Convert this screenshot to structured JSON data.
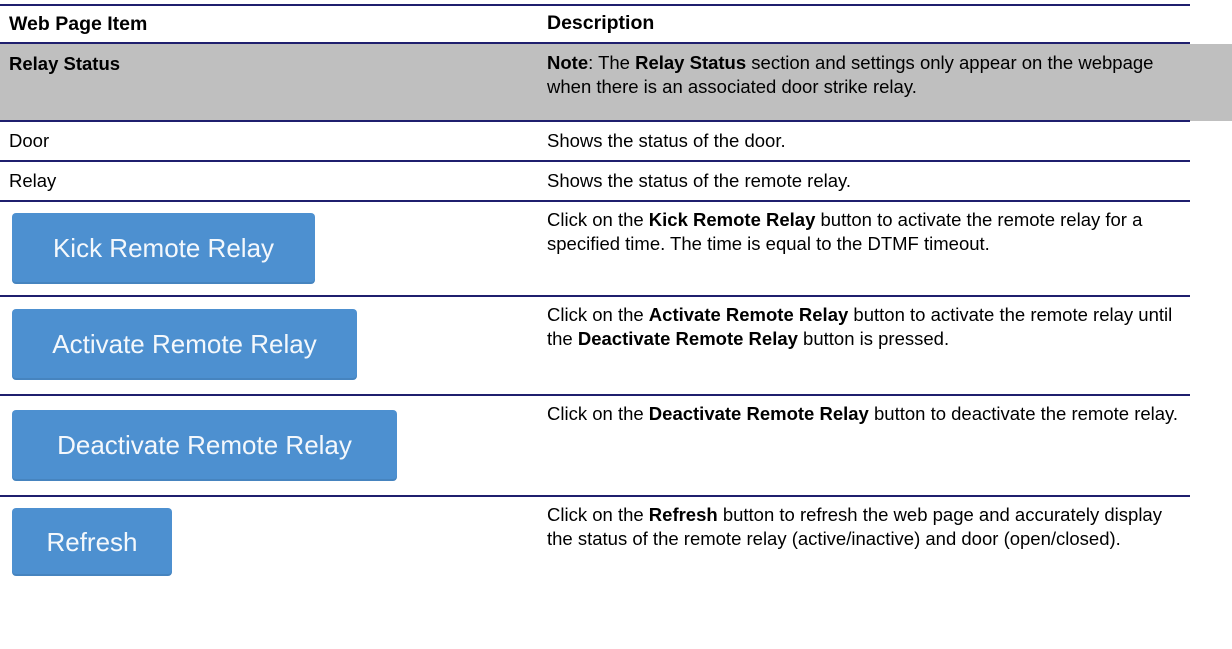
{
  "header": {
    "col1": "Web Page Item",
    "col2": "Description"
  },
  "section": {
    "title": "Relay Status",
    "note_label": "Note",
    "note_1": ": The ",
    "note_bold": "Relay Status",
    "note_2": " section and settings only appear on the webpage when there is an associated door strike relay."
  },
  "rows": [
    {
      "item": "Door",
      "description": "Shows the status of the door."
    },
    {
      "item": "Relay",
      "description": "Shows the status of the remote relay."
    }
  ],
  "buttons": [
    {
      "label": "Kick Remote Relay",
      "d1": "Click on the ",
      "b1": "Kick Remote Relay",
      "d2": " button to activate the remote relay for a specified time. The time is equal to the DTMF timeout."
    },
    {
      "label": "Activate Remote Relay",
      "d1": "Click on the ",
      "b1": "Activate Remote Relay",
      "d2": " button to activate the remote relay until the ",
      "b2": "Deactivate Remote Relay",
      "d3": " button is pressed."
    },
    {
      "label": "Deactivate Remote Relay",
      "d1": "Click on the ",
      "b1": "Deactivate Remote Relay",
      "d2": " button to deactivate the remote relay."
    },
    {
      "label": "Refresh",
      "d1": "Click on the ",
      "b1": "Refresh",
      "d2": " button to refresh the web page and accurately display the status of the remote relay (active/inactive) and door (open/closed)."
    }
  ],
  "colors": {
    "rule": "#1f1f6e",
    "section_bg": "#bfbfbf",
    "button_bg": "#4d90d0",
    "button_text": "#f4f8fc"
  }
}
